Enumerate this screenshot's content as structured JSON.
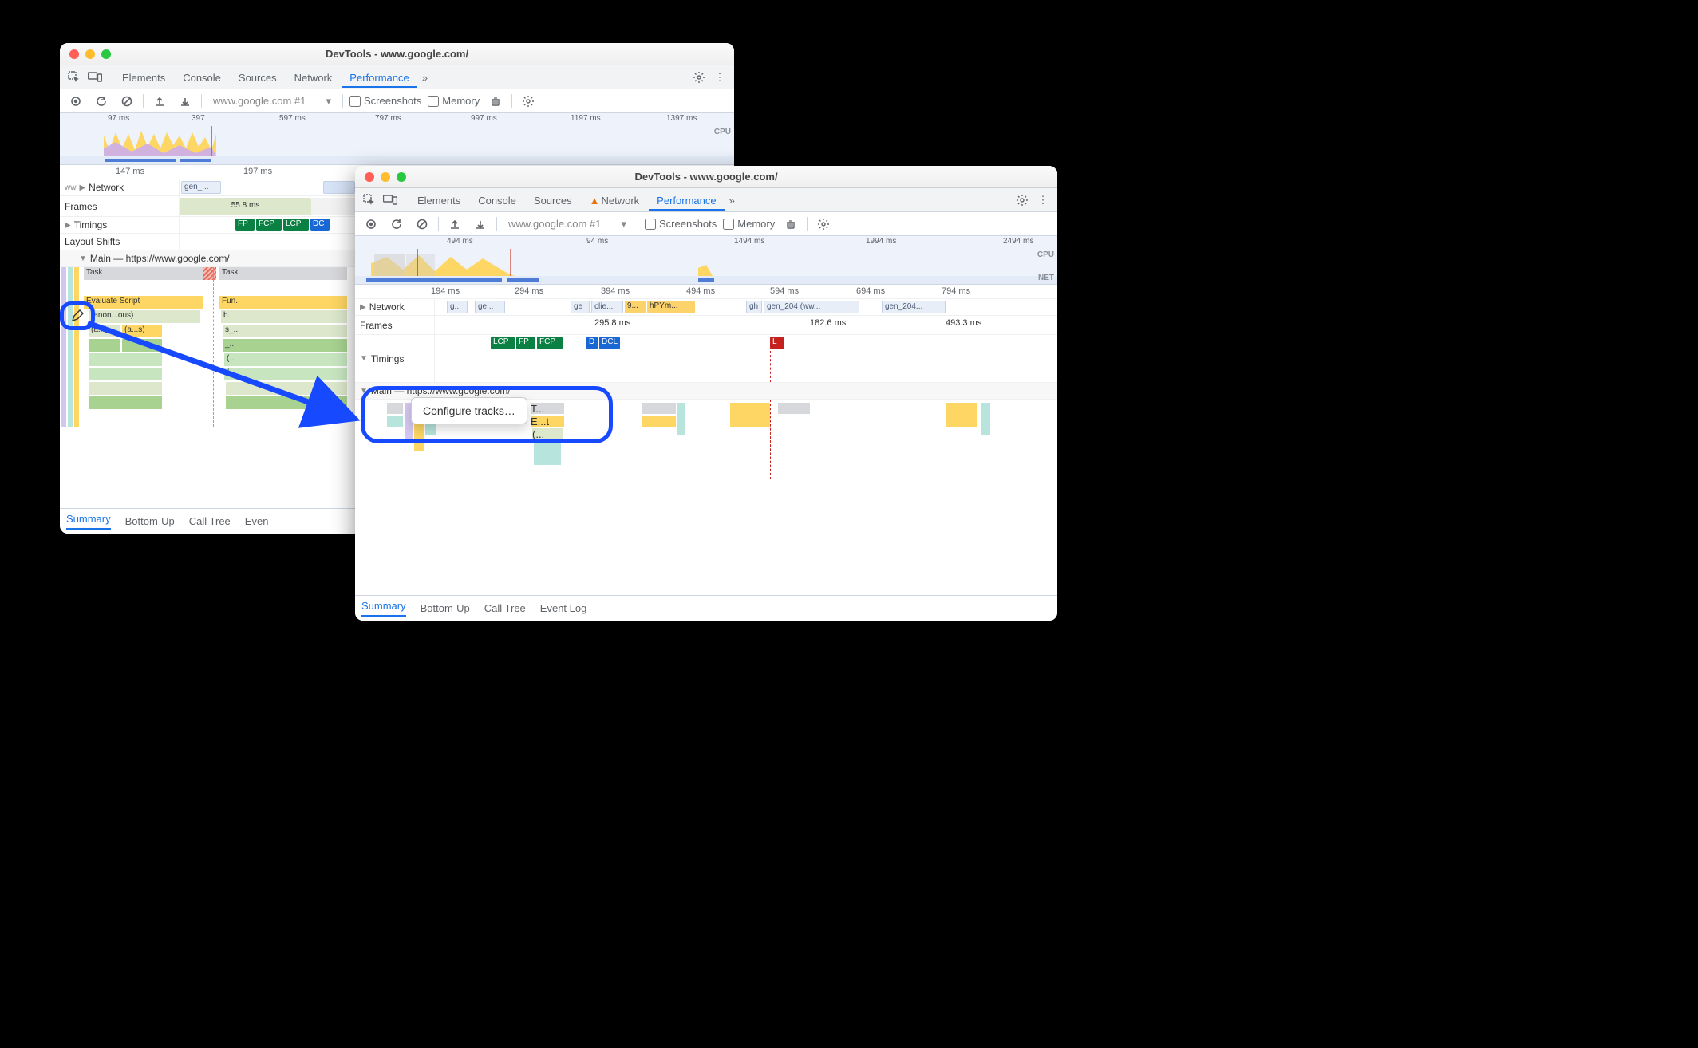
{
  "windowA": {
    "title": "DevTools - www.google.com/",
    "tabs": [
      "Elements",
      "Console",
      "Sources",
      "Network",
      "Performance"
    ],
    "activeTab": "Performance",
    "more": "»",
    "toolbar": {
      "origin": "www.google.com #1",
      "screenshots": "Screenshots",
      "memory": "Memory"
    },
    "overview": {
      "ticks": [
        "97 ms",
        "397",
        "597 ms",
        "797 ms",
        "997 ms",
        "1197 ms",
        "1397 ms"
      ],
      "cpuLabel": "CPU"
    },
    "ruler2": [
      "147 ms",
      "197 ms"
    ],
    "tracks": {
      "ww": "ww",
      "network": "Network",
      "networkItems": [
        "gen_..."
      ],
      "frames": "Frames",
      "framesVal": "55.8 ms",
      "timings": "Timings",
      "timingsChips": [
        "FP",
        "FCP",
        "LCP",
        "DC"
      ],
      "layoutShifts": "Layout Shifts",
      "main": "Main — https://www.google.com/",
      "flameTop": "Task",
      "flameRightTop": "Task",
      "flameRows": [
        "Task",
        "Evaluate Script",
        "(anon...ous)",
        "(a...)",
        "(a...s)"
      ],
      "flameRight": [
        "Fun.",
        "b.",
        "s_...",
        "_...",
        "(...",
        "(..."
      ]
    },
    "bottom": [
      "Summary",
      "Bottom-Up",
      "Call Tree",
      "Even"
    ]
  },
  "windowB": {
    "title": "DevTools - www.google.com/",
    "tabs": [
      "Elements",
      "Console",
      "Sources",
      "Network",
      "Performance"
    ],
    "activeTab": "Performance",
    "networkWarn": true,
    "more": "»",
    "toolbar": {
      "origin": "www.google.com #1",
      "screenshots": "Screenshots",
      "memory": "Memory"
    },
    "overview": {
      "ticks": [
        "494 ms",
        "94 ms",
        "1494 ms",
        "1994 ms",
        "2494 ms"
      ],
      "cpuLabel": "CPU",
      "netLabel": "NET"
    },
    "ruler2": [
      "194 ms",
      "294 ms",
      "394 ms",
      "494 ms",
      "594 ms",
      "694 ms",
      "794 ms"
    ],
    "tracks": {
      "network": "Network",
      "networkItems": [
        "g...",
        "ge...",
        "ge",
        "clie...",
        "9...",
        "hPYm...",
        "gh",
        "gen_204 (ww...",
        "gen_204..."
      ],
      "frames": "Frames",
      "framesVals": [
        "295.8 ms",
        "182.6 ms",
        "493.3 ms"
      ],
      "timings": "Timings",
      "timingsChips": [
        "LCP",
        "FP",
        "FCP",
        "DCL"
      ],
      "timingsL": "L",
      "main": "Main — https://www.google.com/",
      "mainRows": [
        "T...",
        "E...t",
        "(..."
      ]
    },
    "bottom": [
      "Summary",
      "Bottom-Up",
      "Call Tree",
      "Event Log"
    ],
    "contextMenu": "Configure tracks…"
  }
}
